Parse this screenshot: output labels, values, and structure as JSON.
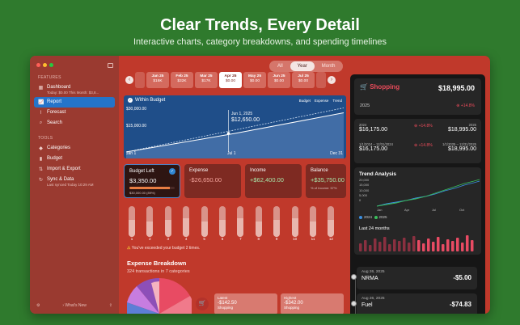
{
  "hero": {
    "title": "Clear Trends, Every Detail",
    "subtitle": "Interactive charts, category breakdowns, and spending timelines"
  },
  "sidebar": {
    "features_label": "FEATURES",
    "tools_label": "TOOLS",
    "items": [
      {
        "label": "Dashboard",
        "sub": "Today: $0.00  This Month: $3,8..."
      },
      {
        "label": "Report"
      },
      {
        "label": "Forecast"
      },
      {
        "label": "Search"
      },
      {
        "label": "Categories"
      },
      {
        "label": "Budget"
      },
      {
        "label": "Import & Export"
      },
      {
        "label": "Sync & Data",
        "sub": "Last synced Today 10:29 AM"
      }
    ],
    "whats_new": "What's New"
  },
  "segment": [
    "All",
    "Year",
    "Month"
  ],
  "months": [
    {
      "m": "Jan 25",
      "v": "$16K"
    },
    {
      "m": "Feb 25",
      "v": "$32K"
    },
    {
      "m": "Mar 25",
      "v": "$17K"
    },
    {
      "m": "Apr 25",
      "v": "$0.00"
    },
    {
      "m": "May 25",
      "v": "$0.00"
    },
    {
      "m": "Jun 25",
      "v": "$0.00"
    },
    {
      "m": "Jul 25",
      "v": "$0.00"
    }
  ],
  "chart": {
    "title": "Within Budget",
    "legend": [
      "Budget",
      "Expense",
      "Trend"
    ],
    "y_labels": [
      "$30,000.00",
      "$15,000.00"
    ],
    "x_labels": [
      "Jan 1",
      "Jul 1",
      "Dec 31"
    ],
    "tooltip_date": "Jun 1, 2025",
    "tooltip_value": "$12,650.00"
  },
  "chart_data": {
    "type": "area",
    "x": [
      "Jan 1",
      "Jul 1",
      "Dec 31"
    ],
    "series": [
      {
        "name": "Budget",
        "values": [
          0,
          15000,
          30000
        ]
      },
      {
        "name": "Expense",
        "values": [
          0,
          12650,
          26650
        ]
      }
    ],
    "ylim": [
      0,
      33000
    ]
  },
  "cards": [
    {
      "title": "Budget Left",
      "value": "$3,350.00",
      "sub": "$30,000.00 (89%)",
      "progress": 0.89
    },
    {
      "title": "Expense",
      "value": "-$26,650.00"
    },
    {
      "title": "Income",
      "value": "+$62,400.00"
    },
    {
      "title": "Balance",
      "value": "+$35,750.00",
      "sub": "% of Income: 57%"
    }
  ],
  "monthly_pills": [
    {
      "label": "1",
      "fill": 0.55
    },
    {
      "label": "2",
      "fill": 0.5
    },
    {
      "label": "3",
      "fill": 0.55
    },
    {
      "label": "4",
      "fill": 0.6
    },
    {
      "label": "5",
      "fill": 0.5
    },
    {
      "label": "6",
      "fill": 0.55
    },
    {
      "label": "7",
      "fill": 0.6
    },
    {
      "label": "8",
      "fill": 0.5
    },
    {
      "label": "9",
      "fill": 0.55
    },
    {
      "label": "10",
      "fill": 0.6
    },
    {
      "label": "11",
      "fill": 0.5
    },
    {
      "label": "12",
      "fill": 0.55
    }
  ],
  "warning": "You've exceeded your budget 2 times.",
  "breakdown": {
    "title": "Expense Breakdown",
    "sub": "324 transactions in 7 categories",
    "latest": {
      "label": "Latest",
      "value": "-$142.50",
      "cat": "Shopping"
    },
    "highest": {
      "label": "Highest",
      "value": "-$342.00",
      "cat": "Shopping"
    }
  },
  "right": {
    "shop_name": "Shopping",
    "shop_amount": "$18,995.00",
    "shop_year": "2025",
    "shop_change": "+14.8%",
    "cmp_row1": {
      "left_label": "2024",
      "left": "$16,175.00",
      "chg": "+14.8%",
      "right_label": "2025",
      "right": "$18,995.00"
    },
    "cmp_row2": {
      "left_label": "1/1/2024 – 12/31/2024",
      "left": "$16,175.00",
      "chg": "+14.8%",
      "right_label": "1/1/2025 – 12/31/2025",
      "right": "$18,995.00"
    },
    "trend_title": "Trend Analysis",
    "trend_y": [
      "20,000",
      "15,000",
      "10,000",
      "5,000",
      "0"
    ],
    "trend_x": [
      "Jan",
      "Apr",
      "Jul",
      "Oct"
    ],
    "trend_legend": [
      "2024",
      "2025"
    ],
    "last24": "Last 24 months",
    "txns": [
      {
        "date": "Aug 26, 2025",
        "name": "NRMA",
        "amount": "-$5.00"
      },
      {
        "date": "Aug 26, 2025",
        "name": "Fuel",
        "amount": "-$74.83"
      }
    ]
  },
  "colors": {
    "accent": "#2574c9",
    "window": "#c0392b",
    "sidebar": "#9a3a30",
    "negative": "#ea4b5a",
    "positive": "#3bbf5c"
  }
}
